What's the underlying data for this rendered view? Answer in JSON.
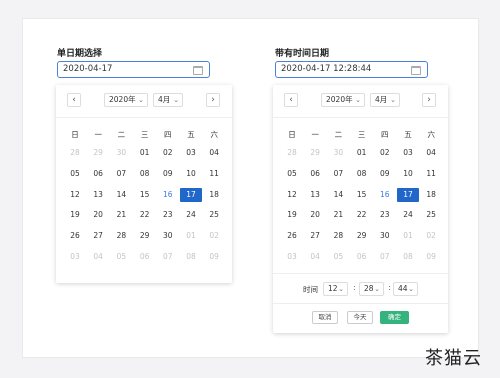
{
  "pickers": [
    {
      "label": "单日期选择",
      "value": "2020-04-17",
      "year": "2020年",
      "month": "4月",
      "weekdays": [
        "日",
        "一",
        "二",
        "三",
        "四",
        "五",
        "六"
      ],
      "days": [
        [
          "28",
          "29",
          "30",
          "01",
          "02",
          "03",
          "04"
        ],
        [
          "05",
          "06",
          "07",
          "08",
          "09",
          "10",
          "11"
        ],
        [
          "12",
          "13",
          "14",
          "15",
          "16",
          "17",
          "18"
        ],
        [
          "19",
          "20",
          "21",
          "22",
          "23",
          "24",
          "25"
        ],
        [
          "26",
          "27",
          "28",
          "29",
          "30",
          "01",
          "02"
        ],
        [
          "03",
          "04",
          "05",
          "06",
          "07",
          "08",
          "09"
        ]
      ]
    },
    {
      "label": "带有时间日期",
      "value": "2020-04-17  12:28:44",
      "year": "2020年",
      "month": "4月",
      "weekdays": [
        "日",
        "一",
        "二",
        "三",
        "四",
        "五",
        "六"
      ],
      "days": [
        [
          "28",
          "29",
          "30",
          "01",
          "02",
          "03",
          "04"
        ],
        [
          "05",
          "06",
          "07",
          "08",
          "09",
          "10",
          "11"
        ],
        [
          "12",
          "13",
          "14",
          "15",
          "16",
          "17",
          "18"
        ],
        [
          "19",
          "20",
          "21",
          "22",
          "23",
          "24",
          "25"
        ],
        [
          "26",
          "27",
          "28",
          "29",
          "30",
          "01",
          "02"
        ],
        [
          "03",
          "04",
          "05",
          "06",
          "07",
          "08",
          "09"
        ]
      ],
      "time": {
        "label": "时间",
        "hour": "12",
        "minute": "28",
        "second": "44"
      },
      "buttons": {
        "cancel": "取消",
        "today": "今天",
        "confirm": "确定"
      }
    }
  ],
  "nav": {
    "prev": "‹",
    "next": "›",
    "chevron": "⌄"
  },
  "watermark": "茶猫云",
  "colors": {
    "accent": "#2166c9",
    "today": "#3a7be0",
    "confirm": "#35b37e",
    "field_border": "#4a82d8"
  }
}
